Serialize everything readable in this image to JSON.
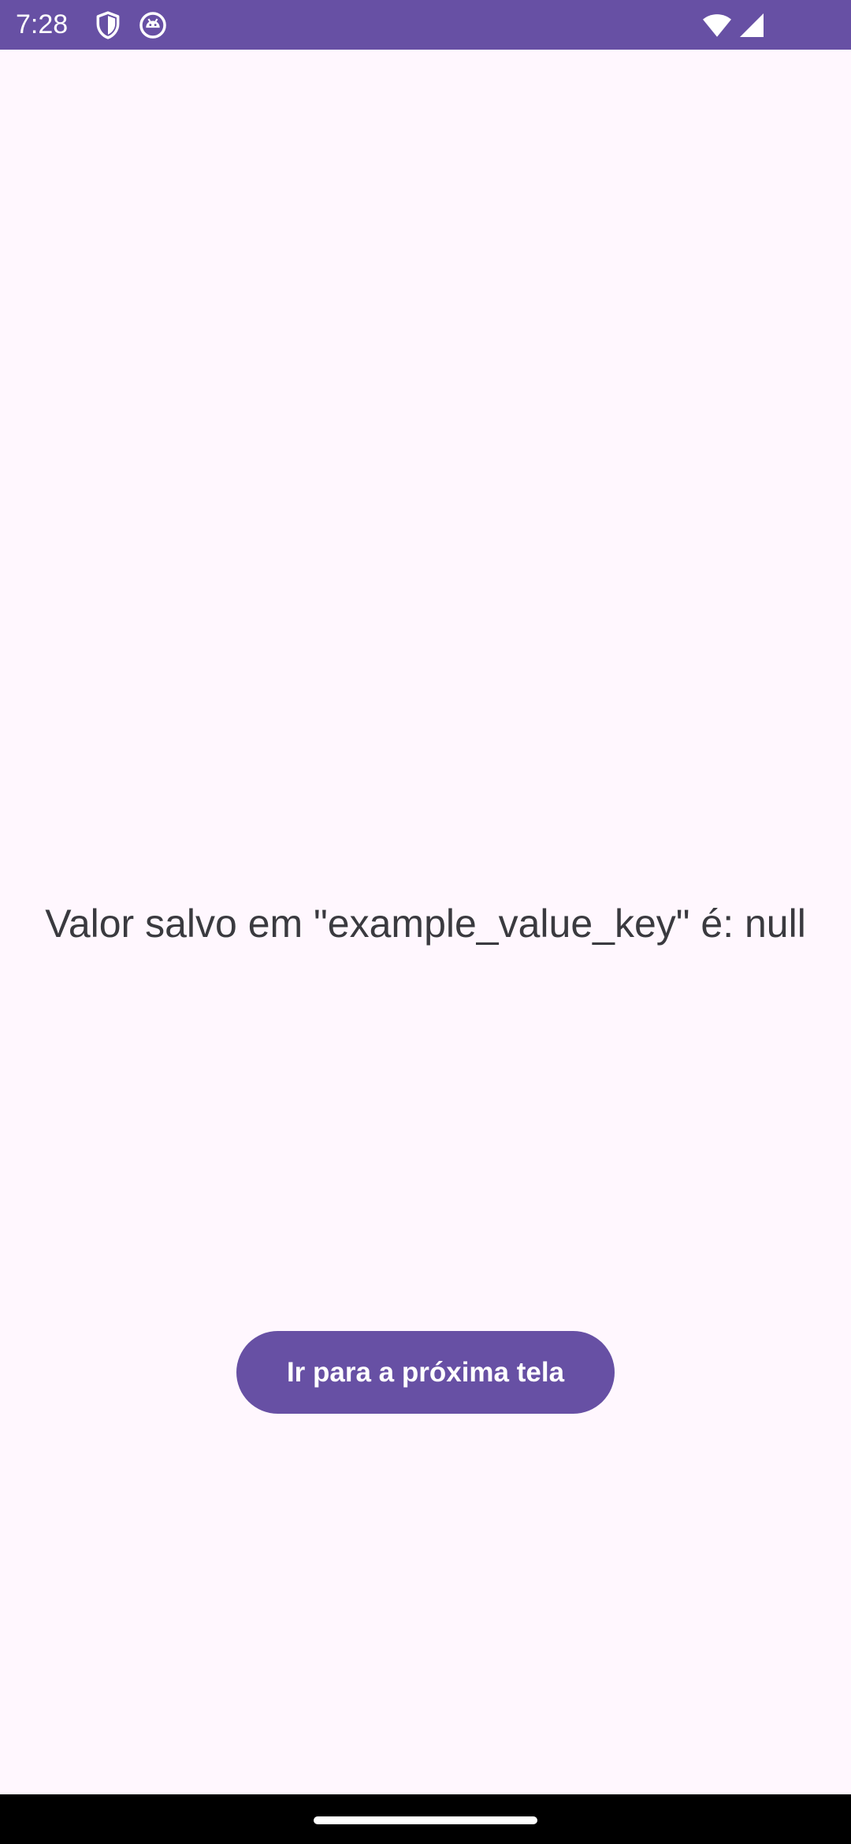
{
  "status_bar": {
    "time": "7:28",
    "background_color": "#6750A4",
    "left_icons": [
      "shield-icon",
      "android-debug-icon"
    ],
    "right_icons": [
      "wifi-icon",
      "cellular-signal-icon"
    ]
  },
  "main": {
    "message": "Valor salvo em \"example_value_key\" é: null",
    "next_button_label": "Ir para a próxima tela",
    "accent_color": "#6750A4",
    "background_color": "#FFF7FE"
  },
  "nav_bar": {
    "handle": "gesture-home-handle"
  }
}
